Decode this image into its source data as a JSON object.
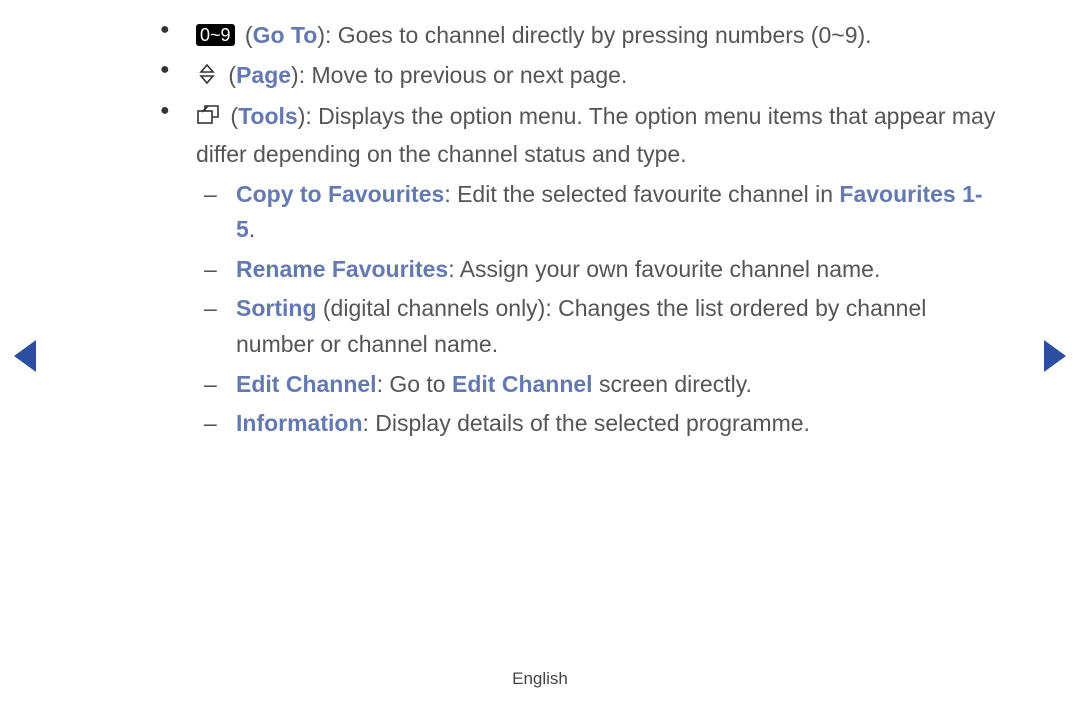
{
  "bullets": {
    "goto": {
      "icon_text": "0~9",
      "label": "Go To",
      "desc": ": Goes to channel directly by pressing numbers (0~9)."
    },
    "page": {
      "label": "Page",
      "desc": ": Move to previous or next page."
    },
    "tools": {
      "label": "Tools",
      "desc1": ": Displays the option menu. The option menu items that appear ",
      "desc2": "may differ depending on the channel status and type."
    }
  },
  "sub": {
    "copy": {
      "label": "Copy to Favourites",
      "desc": ": Edit the selected favourite channel in ",
      "kw2": "Favourites 1-5",
      "dot": "."
    },
    "rename": {
      "label": "Rename Favourites",
      "desc": ": Assign your own favourite channel name."
    },
    "sorting": {
      "label": "Sorting",
      "desc": " (digital channels only): Changes the list ordered by channel number or channel name."
    },
    "edit": {
      "label": "Edit Channel",
      "desc1": ": Go to ",
      "kw2": "Edit Channel",
      "desc2": " screen directly."
    },
    "info": {
      "label": "Information",
      "desc": ": Display details of the selected programme."
    }
  },
  "footer": "English"
}
